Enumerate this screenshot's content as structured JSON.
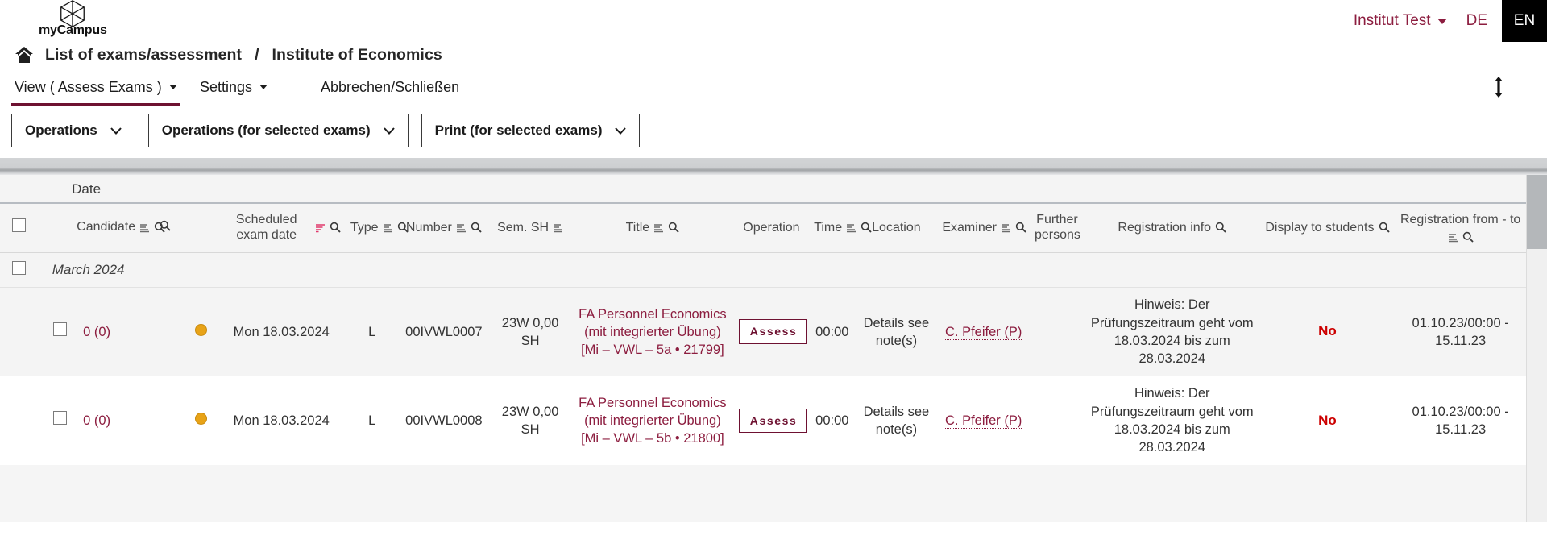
{
  "brand": {
    "name": "myCampus",
    "logo_icon": "cube-hexagon-icon"
  },
  "topbar": {
    "institution_label": "Institut Test",
    "lang_de": "DE",
    "lang_en": "EN",
    "accent_color": "#8c1d3f",
    "active_lang_bg": "#000000"
  },
  "breadcrumb": {
    "home_icon": "home-icon",
    "item1": "List of exams/assessment",
    "separator": "/",
    "item2": "Institute of Economics"
  },
  "tabs": [
    {
      "label": "View ( Assess Exams )",
      "has_caret": true,
      "active": true
    },
    {
      "label": "Settings",
      "has_caret": true,
      "active": false
    },
    {
      "label": "Abbrechen/Schließen",
      "has_caret": false,
      "active": false
    }
  ],
  "toolbar": {
    "buttons": [
      {
        "label": "Operations"
      },
      {
        "label": "Operations (for selected exams)"
      },
      {
        "label": "Print (for selected exams)"
      }
    ],
    "expand_icon": "up-down-arrow-icon"
  },
  "table": {
    "group_header": "Date",
    "columns": [
      {
        "label": "Candidate",
        "sort": true,
        "sort_active": false,
        "search": true,
        "dotted": true,
        "align": "center"
      },
      {
        "label": "",
        "sort": false,
        "sort_active": false,
        "search": true,
        "dotted": false,
        "align": "center"
      },
      {
        "label": "Scheduled exam date",
        "sort": true,
        "sort_active": true,
        "search": true,
        "dotted": false,
        "align": "center"
      },
      {
        "label": "Type",
        "sort": true,
        "sort_active": false,
        "search": true,
        "dotted": false,
        "align": "center"
      },
      {
        "label": "Number",
        "sort": true,
        "sort_active": false,
        "search": true,
        "dotted": false,
        "align": "center"
      },
      {
        "label": "Sem. SH",
        "sort": true,
        "sort_active": false,
        "search": false,
        "dotted": false,
        "align": "center"
      },
      {
        "label": "Title",
        "sort": true,
        "sort_active": false,
        "search": true,
        "dotted": false,
        "align": "center"
      },
      {
        "label": "Operation",
        "sort": false,
        "sort_active": false,
        "search": false,
        "dotted": false,
        "align": "center"
      },
      {
        "label": "Time",
        "sort": true,
        "sort_active": false,
        "search": true,
        "dotted": false,
        "align": "center"
      },
      {
        "label": "Location",
        "sort": false,
        "sort_active": false,
        "search": false,
        "dotted": false,
        "align": "center"
      },
      {
        "label": "Examiner",
        "sort": true,
        "sort_active": false,
        "search": true,
        "dotted": false,
        "align": "center"
      },
      {
        "label": "Further persons",
        "sort": false,
        "sort_active": false,
        "search": false,
        "dotted": false,
        "align": "center"
      },
      {
        "label": "Registration info",
        "sort": false,
        "sort_active": false,
        "search": true,
        "dotted": false,
        "align": "center"
      },
      {
        "label": "Display to students",
        "sort": false,
        "sort_active": false,
        "search": true,
        "dotted": false,
        "align": "center"
      },
      {
        "label": "Registration from - to",
        "sort": true,
        "sort_active": false,
        "search": true,
        "dotted": false,
        "align": "center"
      }
    ],
    "month_group": "March 2024",
    "rows": [
      {
        "candidate": "0 (0)",
        "status_dot_color": "#e8a317",
        "scheduled_exam_date": "Mon 18.03.2024",
        "type": "L",
        "number": "00IVWL0007",
        "sem_sh": "23W 0,00 SH",
        "title": "FA Personnel Economics (mit integrierter Übung) [Mi – VWL – 5a • 21799]",
        "operation": "Assess",
        "time": "00:00",
        "location": "Details see note(s)",
        "examiner": "C. Pfeifer (P)",
        "further_persons": "",
        "registration_info": "Hinweis: Der Prüfungszeitraum geht vom 18.03.2024 bis zum 28.03.2024",
        "display_to_students": "No",
        "registration_from_to": "01.10.23/00:00 - 15.11.23"
      },
      {
        "candidate": "0 (0)",
        "status_dot_color": "#e8a317",
        "scheduled_exam_date": "Mon 18.03.2024",
        "type": "L",
        "number": "00IVWL0008",
        "sem_sh": "23W 0,00 SH",
        "title": "FA Personnel Economics (mit integrierter Übung) [Mi – VWL – 5b • 21800]",
        "operation": "Assess",
        "time": "00:00",
        "location": "Details see note(s)",
        "examiner": "C. Pfeifer (P)",
        "further_persons": "",
        "registration_info": "Hinweis: Der Prüfungszeitraum geht vom 18.03.2024 bis zum 28.03.2024",
        "display_to_students": "No",
        "registration_from_to": "01.10.23/00:00 - 15.11.23"
      }
    ]
  }
}
